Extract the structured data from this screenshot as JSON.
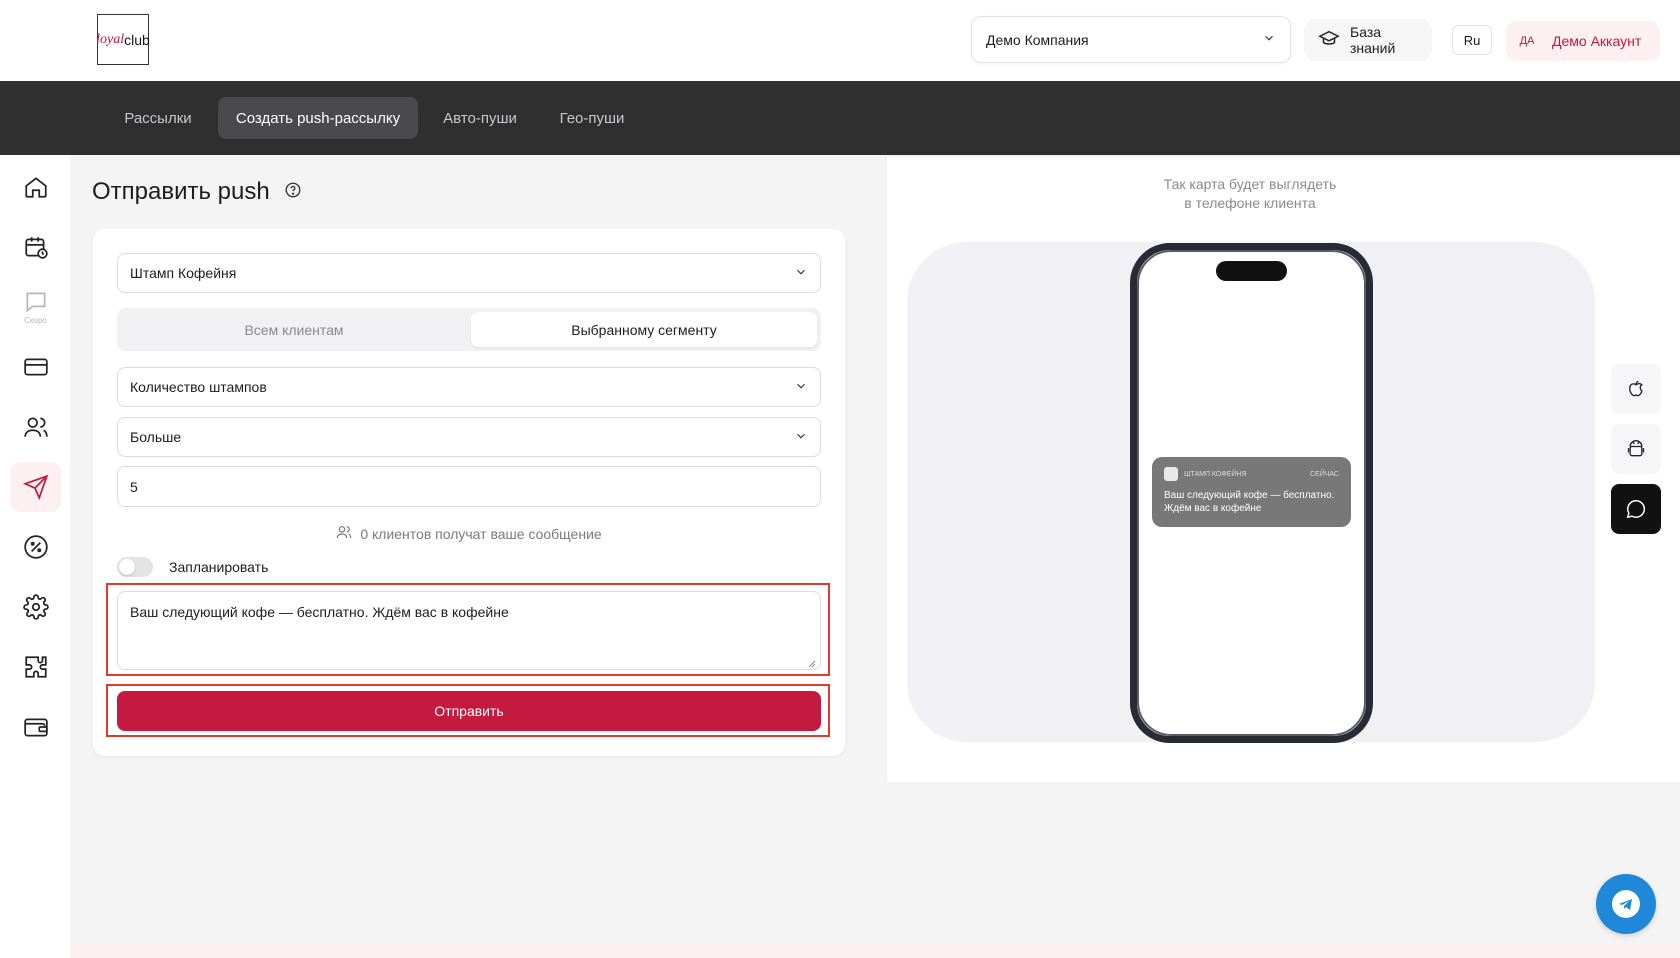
{
  "header": {
    "logo": {
      "part1": "loyal",
      "part2": "club"
    },
    "company": {
      "label": "Демо Компания",
      "icon": "chevron-down-icon"
    },
    "knowledge_base": {
      "label": "База знаний",
      "icon": "graduation-cap-icon"
    },
    "language": "Ru",
    "account": {
      "initials": "ДА",
      "label": "Демо Аккаунт"
    }
  },
  "tabs": [
    {
      "label": "Рассылки",
      "active": false
    },
    {
      "label": "Создать push-рассылку",
      "active": true
    },
    {
      "label": "Авто-пуши",
      "active": false
    },
    {
      "label": "Гео-пуши",
      "active": false
    }
  ],
  "sidebar": {
    "items": [
      {
        "icon": "home-icon"
      },
      {
        "icon": "calendar-clock-icon"
      },
      {
        "icon": "chat-icon",
        "badge": "Скоро"
      },
      {
        "icon": "credit-card-icon"
      },
      {
        "icon": "users-icon"
      },
      {
        "icon": "send-icon",
        "active": true
      },
      {
        "icon": "percent-icon"
      },
      {
        "icon": "gear-icon"
      },
      {
        "icon": "puzzle-icon"
      },
      {
        "icon": "wallet-icon"
      }
    ]
  },
  "form": {
    "title": "Отправить push",
    "card_select": "Штамп Кофейня",
    "audience": {
      "all": "Всем клиентам",
      "segment": "Выбранному сегменту",
      "selected": "segment"
    },
    "criterion_select": "Количество штампов",
    "operator_select": "Больше",
    "value_input": "5",
    "recipients_text": "0 клиентов получат ваше сообщение",
    "schedule_label": "Запланировать",
    "schedule_enabled": false,
    "message": "Ваш следующий кофе — бесплатно. Ждём вас в кофейне",
    "send_label": "Отправить"
  },
  "preview": {
    "caption_line1": "Так карта будет выглядеть",
    "caption_line2": "в телефоне клиента",
    "notification": {
      "app": "ШТАМП КОФЕЙНЯ",
      "time": "СЕЙЧАС",
      "text": "Ваш следующий кофе — бесплатно. Ждём вас в кофейне"
    },
    "os_options": [
      {
        "icon": "apple-icon",
        "active": false
      },
      {
        "icon": "android-icon",
        "active": false
      },
      {
        "icon": "message-bubble-icon",
        "active": true
      }
    ]
  },
  "colors": {
    "accent": "#c41a3f",
    "dark_bar": "#2f2f30",
    "highlight": "#e23b2e",
    "telegram": "#1f88d9"
  }
}
